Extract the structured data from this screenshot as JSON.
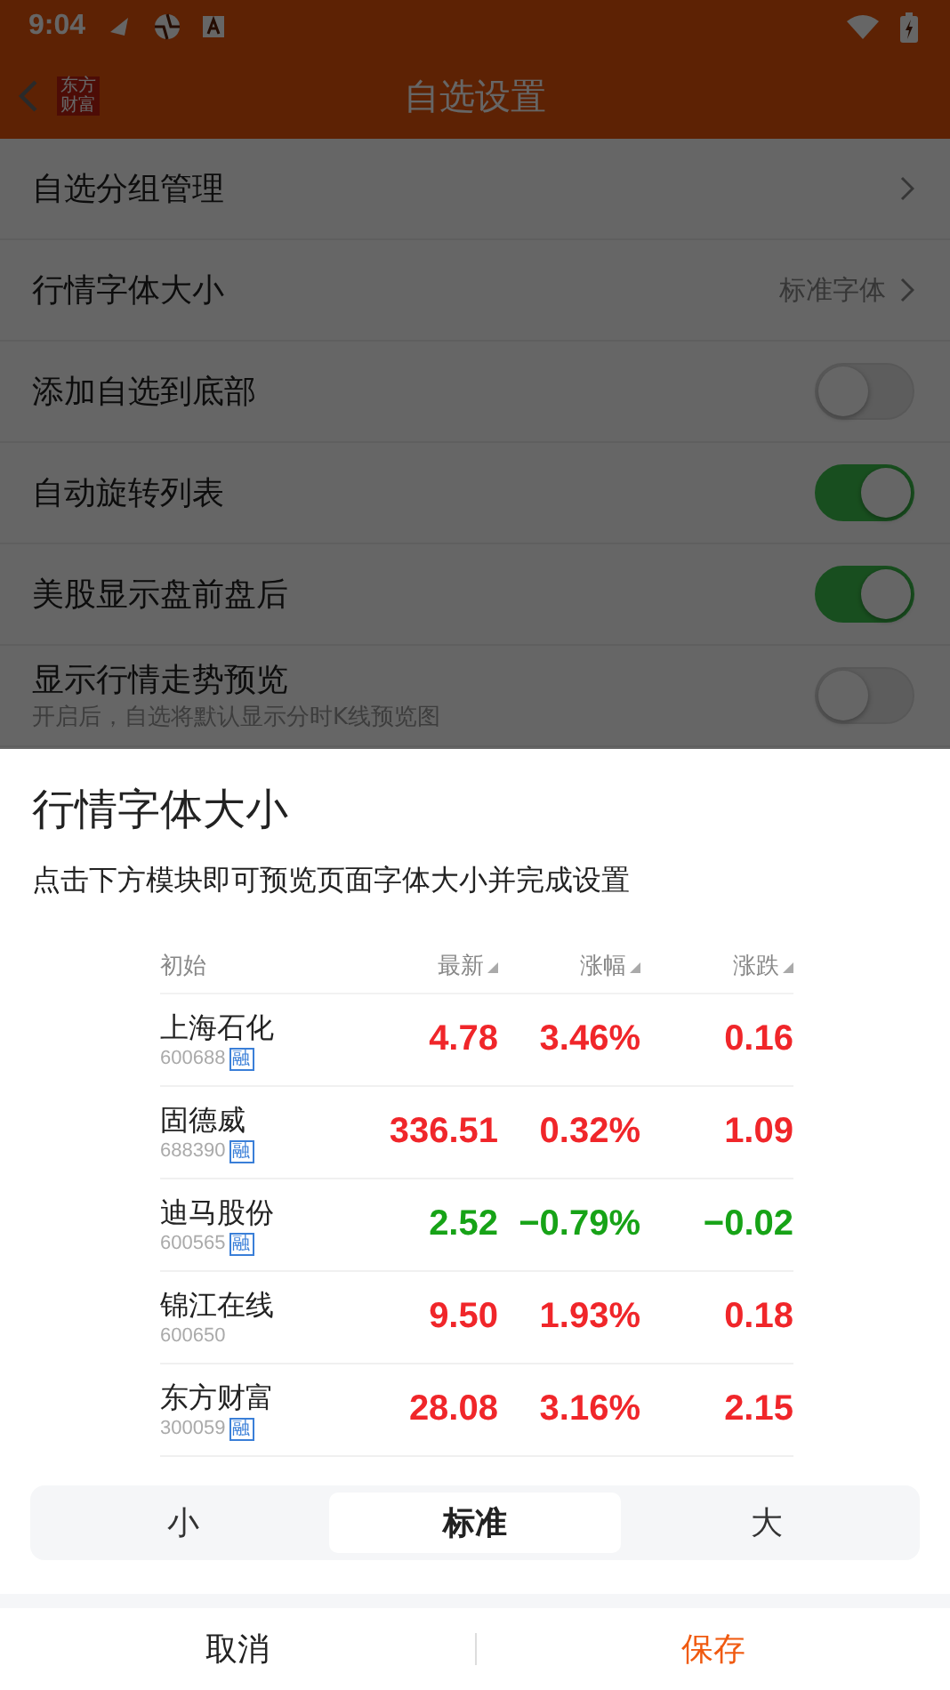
{
  "status_bar": {
    "time": "9:04"
  },
  "header": {
    "logo": "东方财富",
    "title": "自选设置"
  },
  "settings": [
    {
      "kind": "link",
      "label": "自选分组管理"
    },
    {
      "kind": "link",
      "label": "行情字体大小",
      "value": "标准字体"
    },
    {
      "kind": "toggle",
      "label": "添加自选到底部",
      "on": false
    },
    {
      "kind": "toggle",
      "label": "自动旋转列表",
      "on": true
    },
    {
      "kind": "toggle",
      "label": "美股显示盘前盘后",
      "on": true
    },
    {
      "kind": "toggle",
      "label": "显示行情走势预览",
      "subtitle": "开启后，自选将默认显示分时K线预览图",
      "on": false
    }
  ],
  "sheet": {
    "title": "行情字体大小",
    "subtitle": "点击下方模块即可预览页面字体大小并完成设置",
    "columns": [
      "初始",
      "最新",
      "涨幅",
      "涨跌"
    ],
    "rows": [
      {
        "name": "上海石化",
        "code": "600688",
        "tag": "融",
        "color": "#f0262a",
        "price": "4.78",
        "change_pct": "3.46%",
        "change": "0.16"
      },
      {
        "name": "固德威",
        "code": "688390",
        "tag": "融",
        "color": "#f0262a",
        "price": "336.51",
        "change_pct": "0.32%",
        "change": "1.09"
      },
      {
        "name": "迪马股份",
        "code": "600565",
        "tag": "融",
        "color": "#17a317",
        "price": "2.52",
        "change_pct": "−0.79%",
        "change": "−0.02"
      },
      {
        "name": "锦江在线",
        "code": "600650",
        "color": "#f0262a",
        "price": "9.50",
        "change_pct": "1.93%",
        "change": "0.18"
      },
      {
        "name": "东方财富",
        "code": "300059",
        "tag": "融",
        "color": "#f0262a",
        "price": "28.08",
        "change_pct": "3.16%",
        "change": "2.15"
      }
    ],
    "sizes": [
      {
        "label": "小",
        "selected": false
      },
      {
        "label": "标准",
        "selected": true
      },
      {
        "label": "大",
        "selected": false
      }
    ],
    "buttons": [
      "取消",
      "保存"
    ]
  }
}
